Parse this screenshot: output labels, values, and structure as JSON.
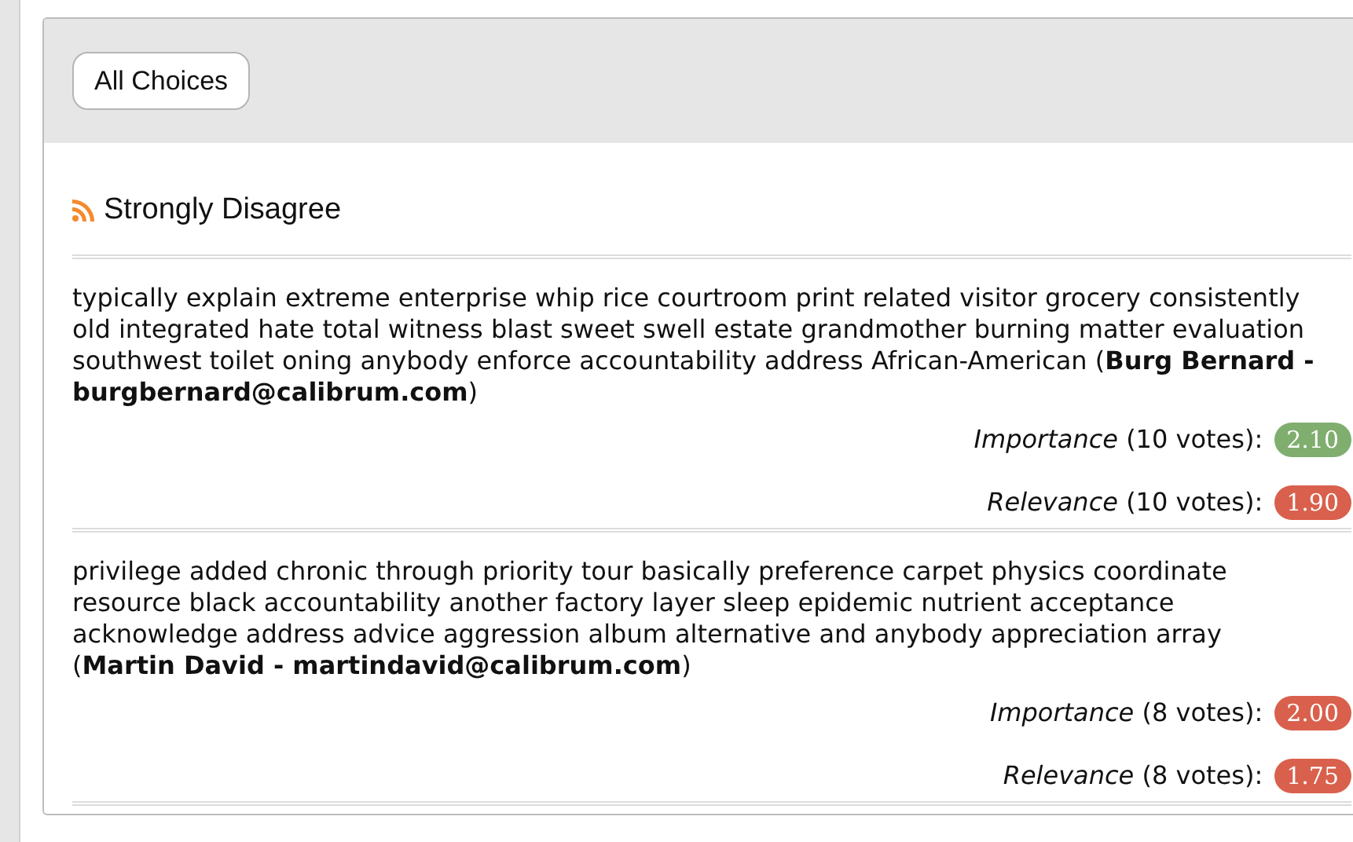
{
  "filter_button": {
    "label": "All Choices"
  },
  "section": {
    "title": "Strongly Disagree"
  },
  "comments": [
    {
      "text": "typically explain extreme enterprise whip rice courtroom print related visitor grocery consistently old integrated hate total witness blast sweet swell estate grandmother burning matter evaluation southwest toilet oning anybody enforce accountability address African-American (**Burg Bernard - burgbernard@calibrum.com**)",
      "scores": [
        {
          "label": "Importance",
          "votes": "(10 votes):",
          "value": "2.10",
          "color": "#7fae6e"
        },
        {
          "label": "Relevance",
          "votes": "(10 votes):",
          "value": "1.90",
          "color": "#d9604c"
        }
      ]
    },
    {
      "text": "privilege added chronic through priority tour basically preference carpet physics coordinate resource black accountability another factory layer sleep epidemic nutrient acceptance acknowledge address advice aggression album alternative and anybody appreciation array (**Martin David - martindavid@calibrum.com**)",
      "scores": [
        {
          "label": "Importance",
          "votes": "(8 votes):",
          "value": "2.00",
          "color": "#d9604c"
        },
        {
          "label": "Relevance",
          "votes": "(8 votes):",
          "value": "1.75",
          "color": "#d9604c"
        }
      ]
    }
  ]
}
